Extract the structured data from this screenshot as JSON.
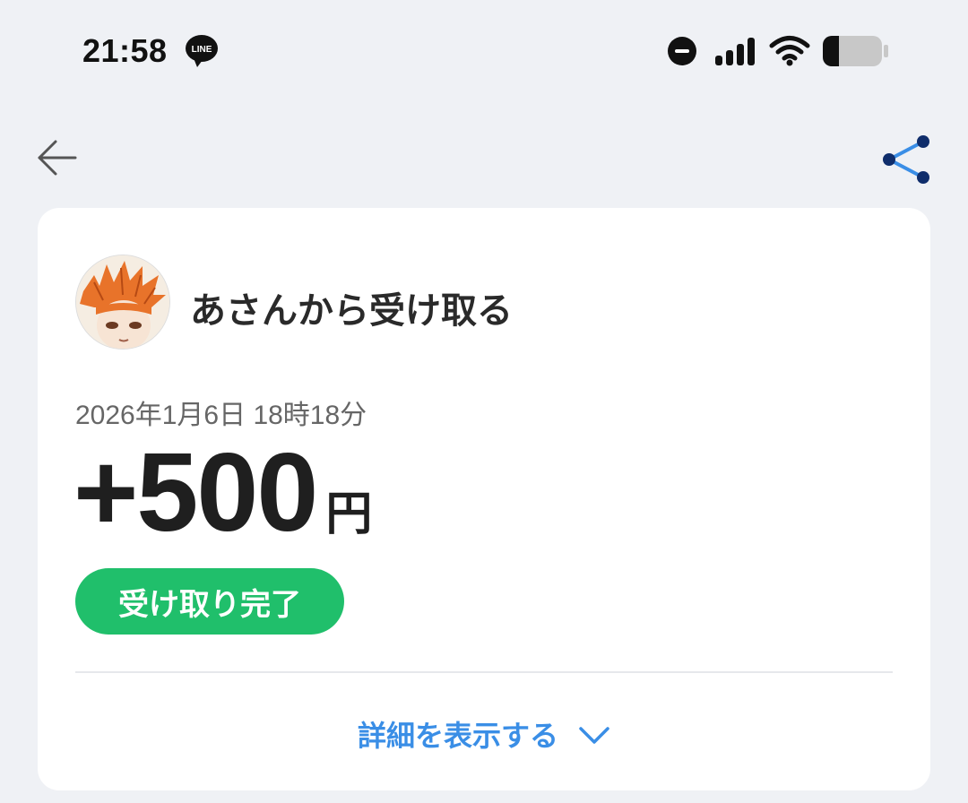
{
  "status_bar": {
    "time": "21:58",
    "icons": [
      "line-app-icon",
      "do-not-disturb-icon",
      "signal-icon",
      "wifi-icon",
      "battery-icon"
    ],
    "line_icon_text": "LINE",
    "battery_level": 0.25
  },
  "nav": {
    "back_icon": "arrow-left-icon",
    "share_icon": "share-icon"
  },
  "transaction": {
    "title": "あさんから受け取る",
    "datetime": "2026年1月6日 18時18分",
    "amount": "+500",
    "currency": "円",
    "status": "受け取り完了",
    "details_label": "詳細を表示する"
  },
  "colors": {
    "background": "#eff1f5",
    "card": "#ffffff",
    "status_green": "#20bf6b",
    "link_blue": "#3a8ee6",
    "share_dark": "#0f2d6b",
    "share_light": "#3a8ee6"
  }
}
